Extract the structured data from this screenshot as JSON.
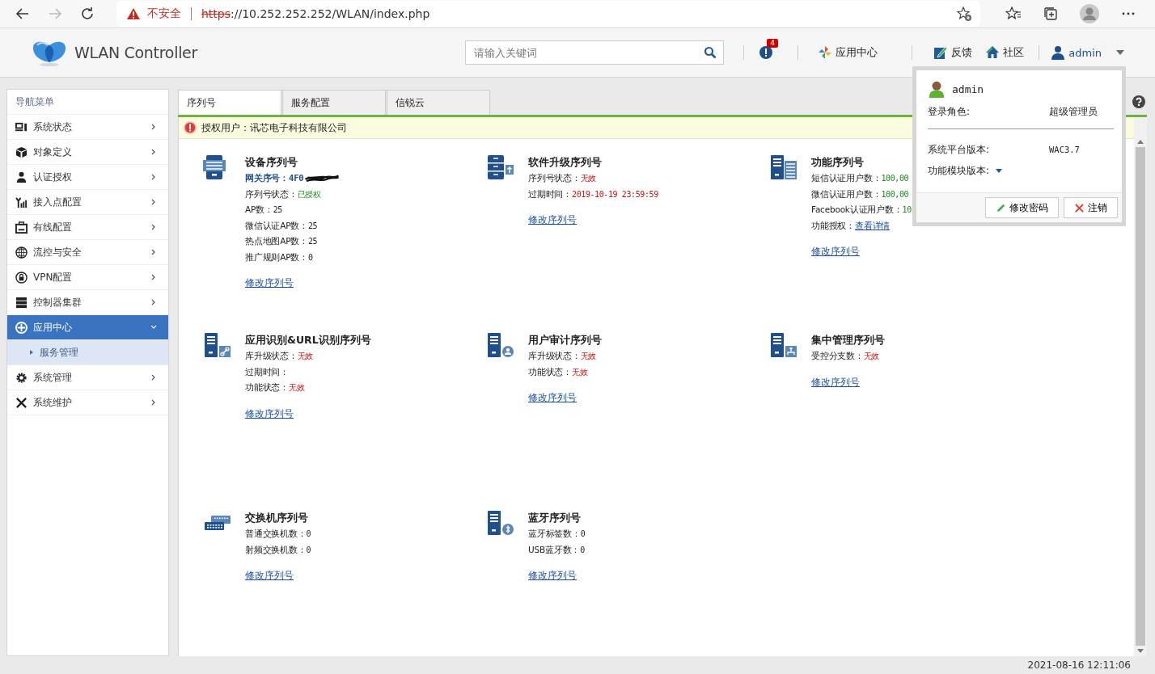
{
  "browser": {
    "security": "不安全",
    "scheme": "https",
    "rest": "://10.252.252.252/WLAN/index.php"
  },
  "header": {
    "product": "WLAN Controller",
    "search": {
      "placeholder": "请输入关键词"
    },
    "alerts": "4",
    "app_center": "应用中心",
    "feedback": "反馈",
    "community": "社区",
    "user": "admin"
  },
  "user_menu": {
    "name": "admin",
    "role_label": "登录角色:",
    "role": "超级管理员",
    "platform_label": "系统平台版本:",
    "platform": "WAC3.7",
    "module_label": "功能模块版本:",
    "buttons": [
      {
        "kind": "edit",
        "label": "修改密码"
      },
      {
        "kind": "logout",
        "label": "注销"
      }
    ]
  },
  "sidebar": {
    "title": "导航菜单",
    "items": [
      {
        "label": "系统状态",
        "selected": false,
        "expanded": false
      },
      {
        "label": "对象定义",
        "selected": false,
        "expanded": false
      },
      {
        "label": "认证授权",
        "selected": false,
        "expanded": false
      },
      {
        "label": "接入点配置",
        "selected": false,
        "expanded": false
      },
      {
        "label": "有线配置",
        "selected": false,
        "expanded": false
      },
      {
        "label": "流控与安全",
        "selected": false,
        "expanded": false
      },
      {
        "label": "VPN配置",
        "selected": false,
        "expanded": false
      },
      {
        "label": "控制器集群",
        "selected": false,
        "expanded": false
      },
      {
        "label": "应用中心",
        "selected": true,
        "expanded": true,
        "children": [
          {
            "label": "服务管理",
            "selected": true
          }
        ]
      },
      {
        "label": "系统管理",
        "selected": false,
        "expanded": false
      },
      {
        "label": "系统维护",
        "selected": false,
        "expanded": false
      }
    ]
  },
  "tabs": [
    {
      "label": "序列号",
      "selected": true
    },
    {
      "label": "服务配置",
      "selected": false
    },
    {
      "label": "信锐云",
      "selected": false
    }
  ],
  "banner": "授权用户：讯芯电子科技有限公司",
  "cards": [
    {
      "title": "设备序列号",
      "lines": [
        {
          "kind": "id",
          "label": "网关序号：",
          "value": "4F0"
        },
        {
          "kind": "text",
          "label": "序列号状态：",
          "value": "已授权",
          "valid": true
        },
        {
          "kind": "text",
          "label": "AP数：",
          "value": "25"
        },
        {
          "kind": "text",
          "label": "微信认证AP数：",
          "value": "25"
        },
        {
          "kind": "text",
          "label": "热点地图AP数：",
          "value": "25"
        },
        {
          "kind": "text",
          "label": "推广规则AP数：",
          "value": "0"
        }
      ],
      "link": "修改序列号"
    },
    {
      "title": "软件升级序列号",
      "lines": [
        {
          "kind": "text",
          "label": "序列号状态：",
          "value": "无效",
          "valid": false
        },
        {
          "kind": "text",
          "label": "过期时间：",
          "value": "2019-10-19 23:59:59",
          "valid": false
        }
      ],
      "link": "修改序列号"
    },
    {
      "title": "功能序列号",
      "lines": [
        {
          "kind": "text",
          "label": "短信认证用户数：",
          "value": "100,00",
          "valid": true
        },
        {
          "kind": "text",
          "label": "微信认证用户数：",
          "value": "100,00",
          "valid": true
        },
        {
          "kind": "text",
          "label": "Facebook认证用户数：",
          "value": "10",
          "valid": true
        },
        {
          "kind": "link",
          "label": "功能授权：",
          "value": "查看详情"
        }
      ],
      "link": "修改序列号"
    },
    {
      "title": "应用识别&URL识别序列号",
      "lines": [
        {
          "kind": "text",
          "label": "库升级状态：",
          "value": "无效",
          "valid": false
        },
        {
          "kind": "text",
          "label": "过期时间："
        },
        {
          "kind": "text",
          "label": "功能状态：",
          "value": "无效",
          "valid": false
        }
      ],
      "link": "修改序列号"
    },
    {
      "title": "用户审计序列号",
      "lines": [
        {
          "kind": "text",
          "label": "库升级状态：",
          "value": "无效",
          "valid": false
        },
        {
          "kind": "text",
          "label": "功能状态：",
          "value": "无效",
          "valid": false
        }
      ],
      "link": "修改序列号"
    },
    {
      "title": "集中管理序列号",
      "lines": [
        {
          "kind": "text",
          "label": "受控分支数：",
          "value": "无效",
          "valid": false
        }
      ],
      "link": "修改序列号"
    },
    {
      "title": "交换机序列号",
      "lines": [
        {
          "kind": "text",
          "label": "普通交换机数：",
          "value": "0"
        },
        {
          "kind": "text",
          "label": "射频交换机数：",
          "value": "0"
        }
      ],
      "link": "修改序列号"
    },
    {
      "title": "蓝牙序列号",
      "lines": [
        {
          "kind": "text",
          "label": "蓝牙标签数：",
          "value": "0"
        },
        {
          "kind": "text",
          "label": "USB蓝牙数：",
          "value": "0"
        }
      ],
      "link": "修改序列号"
    }
  ],
  "status_bar": {
    "time": "2021-08-16 12:11:06"
  }
}
